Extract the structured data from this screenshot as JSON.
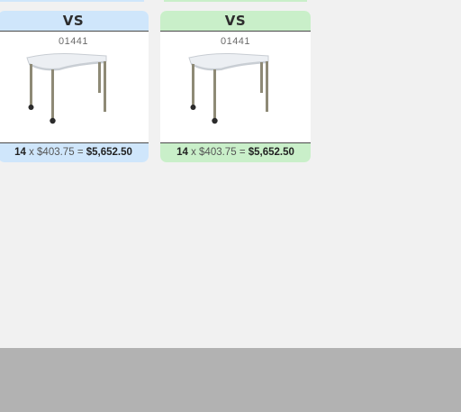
{
  "cards": [
    {
      "header": "VS",
      "code": "01441",
      "qty": "14",
      "times": "x",
      "unit_price": "$403.75",
      "equals": "=",
      "total": "$5,652.50",
      "accent": "#cfe6fb"
    },
    {
      "header": "VS",
      "code": "01441",
      "qty": "14",
      "times": "x",
      "unit_price": "$403.75",
      "equals": "=",
      "total": "$5,652.50",
      "accent": "#c9efc9"
    }
  ],
  "image_icon": "desk-table-icon"
}
